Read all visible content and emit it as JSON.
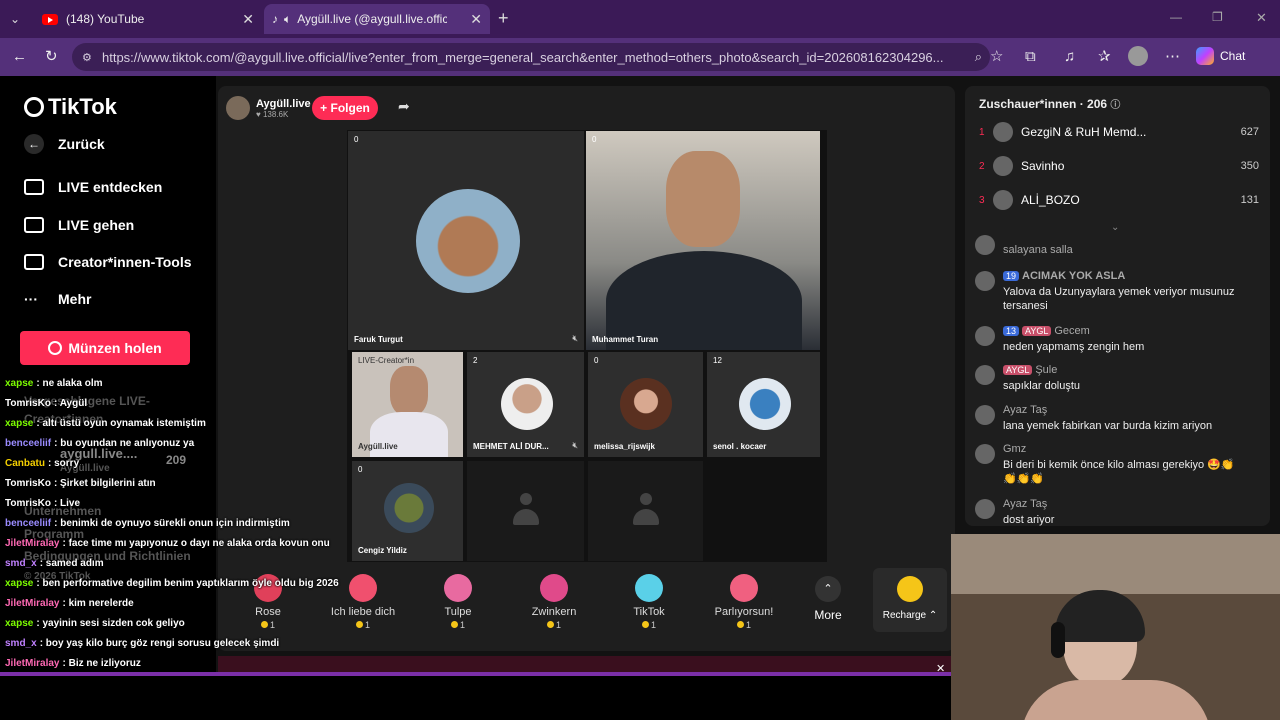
{
  "browser": {
    "tabs": [
      {
        "title": "(148) YouTube"
      },
      {
        "title": "Aygüll.live (@aygull.live.offici"
      }
    ],
    "url": "https://www.tiktok.com/@aygull.live.official/live?enter_from_merge=general_search&enter_method=others_photo&search_id=202608162304296...",
    "chat_label": "Chat"
  },
  "sidebar": {
    "brand": "TikTok",
    "back": "Zurück",
    "items": [
      {
        "label": "LIVE entdecken"
      },
      {
        "label": "LIVE gehen"
      },
      {
        "label": "Creator*innen-Tools"
      },
      {
        "label": "Mehr"
      }
    ],
    "coins_button": "Münzen holen",
    "ghost": {
      "a": "Vorgeschlagene LIVE-",
      "b": "Creator*innen",
      "c": "aygull.live....",
      "d": "209",
      "e": "Aygüll.live",
      "f": "Unternehmen",
      "g": "Programm",
      "h": "Bedingungen und Richtlinien",
      "i": "© 2026 TikTok"
    }
  },
  "live": {
    "host_name": "Aygüll.live",
    "host_likes": "138.6K",
    "follow": "+ Folgen",
    "tiles": [
      {
        "name": "Faruk Turgut",
        "count": "0"
      },
      {
        "name": "Muhammet Turan",
        "count": "0"
      },
      {
        "name": "Aygüll.live",
        "count": "LIVE-Creator*in"
      },
      {
        "name": "MEHMET ALİ DUR...",
        "count": "2"
      },
      {
        "name": "melissa_rijswijk",
        "count": "0"
      },
      {
        "name": "senol . kocaer",
        "count": "12"
      },
      {
        "name": "Cengiz Yildiz",
        "count": "0"
      }
    ],
    "gifts": [
      {
        "name": "Rose",
        "price": "1",
        "color": "#e0405a"
      },
      {
        "name": "Ich liebe dich",
        "price": "1",
        "color": "#f0506e"
      },
      {
        "name": "Tulpe",
        "price": "1",
        "color": "#e86aa0"
      },
      {
        "name": "Zwinkern",
        "price": "1",
        "color": "#e04a8a"
      },
      {
        "name": "TikTok",
        "price": "1",
        "color": "#5ad0e8"
      },
      {
        "name": "Parlıyorsun!",
        "price": "1",
        "color": "#f06080"
      }
    ],
    "more": "More",
    "recharge": "Recharge"
  },
  "viewers": {
    "title": "Zuschauer*innen · 206",
    "top": [
      {
        "rank": "1",
        "name": "GezgiN & RuH Memd...",
        "score": "627"
      },
      {
        "rank": "2",
        "name": "Savinho",
        "score": "350"
      },
      {
        "rank": "3",
        "name": "ALİ_BOZO",
        "score": "131"
      }
    ],
    "comments": [
      {
        "user": "salayana salla",
        "text": ""
      },
      {
        "user": "ACIMAK YOK ASLA",
        "badge": "19",
        "text": "Yalova da Uzunyaylara yemek veriyor musunuz tersanesi"
      },
      {
        "user": "Gecem",
        "badge": "13",
        "badge2": "AYGL",
        "text": "neden yapmamş zengin hem"
      },
      {
        "user": "Şule",
        "badge2": "AYGL",
        "text": "sapıklar doluştu"
      },
      {
        "user": "Ayaz Taş",
        "text": "lana yemek fabirkan var burda kizim ariyon"
      },
      {
        "user": "Gmz",
        "text": "Bi deri bi kemik önce kilo alması gerekiyo 🤩👏👏👏👏"
      },
      {
        "user": "Ayaz Taş",
        "text": "dost ariyor"
      }
    ]
  },
  "chat_overlay": [
    {
      "user": "xapse",
      "color": "#7cfc00",
      "text": "ne alaka olm"
    },
    {
      "user": "TomrisKo",
      "color": "#fff",
      "text": "Aygül"
    },
    {
      "user": "xapse",
      "color": "#7cfc00",
      "text": "altı üstü oyun oynamak istemiştim"
    },
    {
      "user": "benceeliif",
      "color": "#9b8cff",
      "text": "bu oyundan ne anlıyonuz ya"
    },
    {
      "user": "Canbatu",
      "color": "#f5d000",
      "text": "sorry"
    },
    {
      "user": "TomrisKo",
      "color": "#fff",
      "text": "Şirket bilgilerini atın"
    },
    {
      "user": "TomrisKo",
      "color": "#fff",
      "text": "Live"
    },
    {
      "user": "benceeliif",
      "color": "#9b8cff",
      "text": "benimki de oynuyo sürekli onun için indirmiştim"
    },
    {
      "user": "JiletMiralay",
      "color": "#ff69b4",
      "text": "face time mı yapıyonuz o dayı ne alaka orda kovun onu"
    },
    {
      "user": "smd_x",
      "color": "#c080ff",
      "text": "samed adım"
    },
    {
      "user": "xapse",
      "color": "#7cfc00",
      "text": "ben performative degilim benim yaptıklarım öyle oldu big 2026"
    },
    {
      "user": "JiletMiralay",
      "color": "#ff69b4",
      "text": "kim nerelerde"
    },
    {
      "user": "xapse",
      "color": "#7cfc00",
      "text": "yayinin sesi sizden cok geliyo"
    },
    {
      "user": "smd_x",
      "color": "#c080ff",
      "text": "boy yaş kilo burç göz rengi sorusu gelecek şimdi"
    },
    {
      "user": "JiletMiralay",
      "color": "#ff69b4",
      "text": "Biz ne izliyoruz"
    }
  ]
}
